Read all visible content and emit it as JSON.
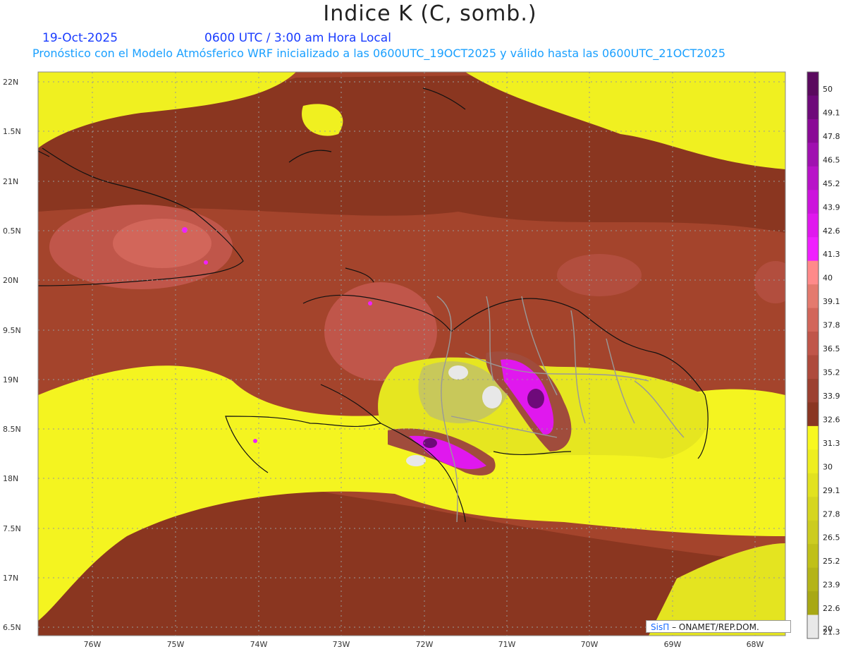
{
  "header": {
    "title": "Indice K (C, somb.)",
    "date": "19-Oct-2025",
    "time": "0600 UTC / 3:00 am Hora Local",
    "description": "Pronóstico con el Modelo Atmósferico WRF inicializado a las 0600UTC_19OCT2025 y válido hasta las  0600UTC_21OCT2025"
  },
  "axes": {
    "lat_labels": [
      "22N",
      "1.5N",
      "21N",
      "0.5N",
      "20N",
      "9.5N",
      "19N",
      "8.5N",
      "18N",
      "7.5N",
      "17N",
      "6.5N"
    ],
    "lon_labels": [
      "76W",
      "75W",
      "74W",
      "73W",
      "72W",
      "71W",
      "70W",
      "69W",
      "68W"
    ]
  },
  "colorbar": {
    "labels": [
      "50",
      "49.1",
      "47.8",
      "46.5",
      "45.2",
      "43.9",
      "42.6",
      "41.3",
      "40",
      "39.1",
      "37.8",
      "36.5",
      "35.2",
      "33.9",
      "32.6",
      "31.3",
      "30",
      "29.1",
      "27.8",
      "26.5",
      "25.2",
      "23.9",
      "22.6",
      "21.3",
      "20"
    ],
    "colors": [
      "#5a0a5e",
      "#6e0a7a",
      "#8a0a96",
      "#a010b0",
      "#b812c8",
      "#cc14dc",
      "#e018ee",
      "#f020ff",
      "#ff8a8a",
      "#e47a6e",
      "#d2665a",
      "#c0564a",
      "#ae4a3c",
      "#9c4030",
      "#8a3622",
      "#f8f820",
      "#eeee20",
      "#e2e220",
      "#d6d620",
      "#cccc20",
      "#c0c018",
      "#b4b418",
      "#a8a814",
      "#e8e8e8"
    ]
  },
  "credit": {
    "brand": "SisΠ",
    "text": "– ONAMET/REP.DOM."
  }
}
